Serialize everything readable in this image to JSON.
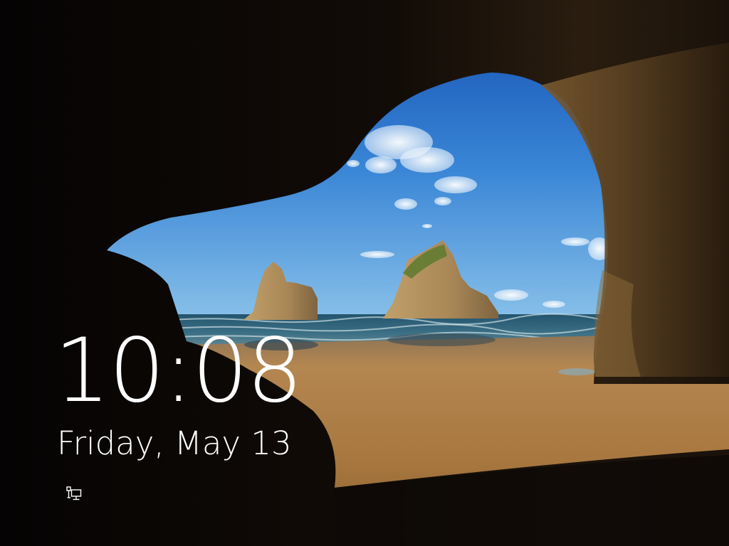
{
  "lock_screen": {
    "time": "10:08",
    "date": "Friday, May 13"
  },
  "status_icons": [
    {
      "icon": "network-ethernet-icon"
    }
  ],
  "colors": {
    "text": "#ffffff",
    "sky_top": "#1a5fbf",
    "sky_bottom": "#6eaee6",
    "sea": "#2a5f7a",
    "sand": "#b0834e",
    "cave_rock": "#6a4e2c"
  }
}
